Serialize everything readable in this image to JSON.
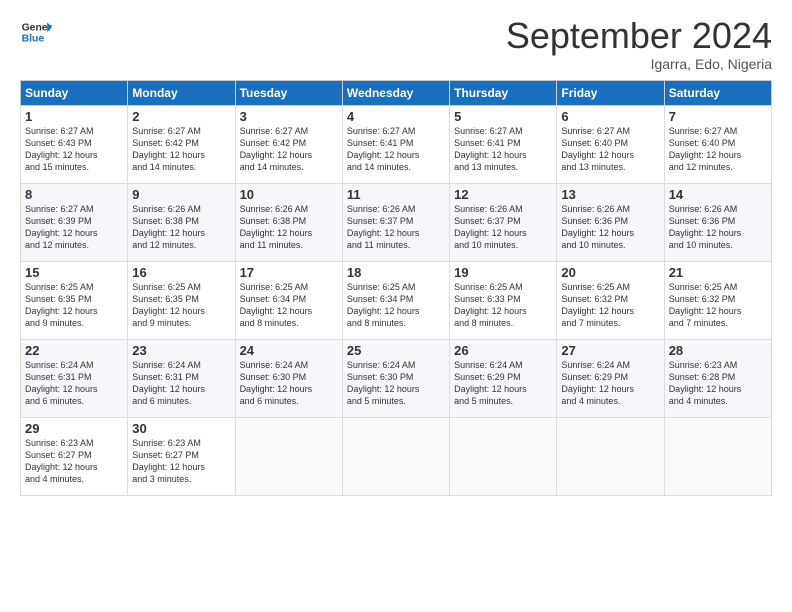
{
  "header": {
    "logo_general": "General",
    "logo_blue": "Blue",
    "month_title": "September 2024",
    "subtitle": "Igarra, Edo, Nigeria"
  },
  "days_of_week": [
    "Sunday",
    "Monday",
    "Tuesday",
    "Wednesday",
    "Thursday",
    "Friday",
    "Saturday"
  ],
  "weeks": [
    [
      {
        "day": 1,
        "lines": [
          "Sunrise: 6:27 AM",
          "Sunset: 6:43 PM",
          "Daylight: 12 hours",
          "and 15 minutes."
        ]
      },
      {
        "day": 2,
        "lines": [
          "Sunrise: 6:27 AM",
          "Sunset: 6:42 PM",
          "Daylight: 12 hours",
          "and 14 minutes."
        ]
      },
      {
        "day": 3,
        "lines": [
          "Sunrise: 6:27 AM",
          "Sunset: 6:42 PM",
          "Daylight: 12 hours",
          "and 14 minutes."
        ]
      },
      {
        "day": 4,
        "lines": [
          "Sunrise: 6:27 AM",
          "Sunset: 6:41 PM",
          "Daylight: 12 hours",
          "and 14 minutes."
        ]
      },
      {
        "day": 5,
        "lines": [
          "Sunrise: 6:27 AM",
          "Sunset: 6:41 PM",
          "Daylight: 12 hours",
          "and 13 minutes."
        ]
      },
      {
        "day": 6,
        "lines": [
          "Sunrise: 6:27 AM",
          "Sunset: 6:40 PM",
          "Daylight: 12 hours",
          "and 13 minutes."
        ]
      },
      {
        "day": 7,
        "lines": [
          "Sunrise: 6:27 AM",
          "Sunset: 6:40 PM",
          "Daylight: 12 hours",
          "and 12 minutes."
        ]
      }
    ],
    [
      {
        "day": 8,
        "lines": [
          "Sunrise: 6:27 AM",
          "Sunset: 6:39 PM",
          "Daylight: 12 hours",
          "and 12 minutes."
        ]
      },
      {
        "day": 9,
        "lines": [
          "Sunrise: 6:26 AM",
          "Sunset: 6:38 PM",
          "Daylight: 12 hours",
          "and 12 minutes."
        ]
      },
      {
        "day": 10,
        "lines": [
          "Sunrise: 6:26 AM",
          "Sunset: 6:38 PM",
          "Daylight: 12 hours",
          "and 11 minutes."
        ]
      },
      {
        "day": 11,
        "lines": [
          "Sunrise: 6:26 AM",
          "Sunset: 6:37 PM",
          "Daylight: 12 hours",
          "and 11 minutes."
        ]
      },
      {
        "day": 12,
        "lines": [
          "Sunrise: 6:26 AM",
          "Sunset: 6:37 PM",
          "Daylight: 12 hours",
          "and 10 minutes."
        ]
      },
      {
        "day": 13,
        "lines": [
          "Sunrise: 6:26 AM",
          "Sunset: 6:36 PM",
          "Daylight: 12 hours",
          "and 10 minutes."
        ]
      },
      {
        "day": 14,
        "lines": [
          "Sunrise: 6:26 AM",
          "Sunset: 6:36 PM",
          "Daylight: 12 hours",
          "and 10 minutes."
        ]
      }
    ],
    [
      {
        "day": 15,
        "lines": [
          "Sunrise: 6:25 AM",
          "Sunset: 6:35 PM",
          "Daylight: 12 hours",
          "and 9 minutes."
        ]
      },
      {
        "day": 16,
        "lines": [
          "Sunrise: 6:25 AM",
          "Sunset: 6:35 PM",
          "Daylight: 12 hours",
          "and 9 minutes."
        ]
      },
      {
        "day": 17,
        "lines": [
          "Sunrise: 6:25 AM",
          "Sunset: 6:34 PM",
          "Daylight: 12 hours",
          "and 8 minutes."
        ]
      },
      {
        "day": 18,
        "lines": [
          "Sunrise: 6:25 AM",
          "Sunset: 6:34 PM",
          "Daylight: 12 hours",
          "and 8 minutes."
        ]
      },
      {
        "day": 19,
        "lines": [
          "Sunrise: 6:25 AM",
          "Sunset: 6:33 PM",
          "Daylight: 12 hours",
          "and 8 minutes."
        ]
      },
      {
        "day": 20,
        "lines": [
          "Sunrise: 6:25 AM",
          "Sunset: 6:32 PM",
          "Daylight: 12 hours",
          "and 7 minutes."
        ]
      },
      {
        "day": 21,
        "lines": [
          "Sunrise: 6:25 AM",
          "Sunset: 6:32 PM",
          "Daylight: 12 hours",
          "and 7 minutes."
        ]
      }
    ],
    [
      {
        "day": 22,
        "lines": [
          "Sunrise: 6:24 AM",
          "Sunset: 6:31 PM",
          "Daylight: 12 hours",
          "and 6 minutes."
        ]
      },
      {
        "day": 23,
        "lines": [
          "Sunrise: 6:24 AM",
          "Sunset: 6:31 PM",
          "Daylight: 12 hours",
          "and 6 minutes."
        ]
      },
      {
        "day": 24,
        "lines": [
          "Sunrise: 6:24 AM",
          "Sunset: 6:30 PM",
          "Daylight: 12 hours",
          "and 6 minutes."
        ]
      },
      {
        "day": 25,
        "lines": [
          "Sunrise: 6:24 AM",
          "Sunset: 6:30 PM",
          "Daylight: 12 hours",
          "and 5 minutes."
        ]
      },
      {
        "day": 26,
        "lines": [
          "Sunrise: 6:24 AM",
          "Sunset: 6:29 PM",
          "Daylight: 12 hours",
          "and 5 minutes."
        ]
      },
      {
        "day": 27,
        "lines": [
          "Sunrise: 6:24 AM",
          "Sunset: 6:29 PM",
          "Daylight: 12 hours",
          "and 4 minutes."
        ]
      },
      {
        "day": 28,
        "lines": [
          "Sunrise: 6:23 AM",
          "Sunset: 6:28 PM",
          "Daylight: 12 hours",
          "and 4 minutes."
        ]
      }
    ],
    [
      {
        "day": 29,
        "lines": [
          "Sunrise: 6:23 AM",
          "Sunset: 6:27 PM",
          "Daylight: 12 hours",
          "and 4 minutes."
        ]
      },
      {
        "day": 30,
        "lines": [
          "Sunrise: 6:23 AM",
          "Sunset: 6:27 PM",
          "Daylight: 12 hours",
          "and 3 minutes."
        ]
      },
      null,
      null,
      null,
      null,
      null
    ]
  ]
}
